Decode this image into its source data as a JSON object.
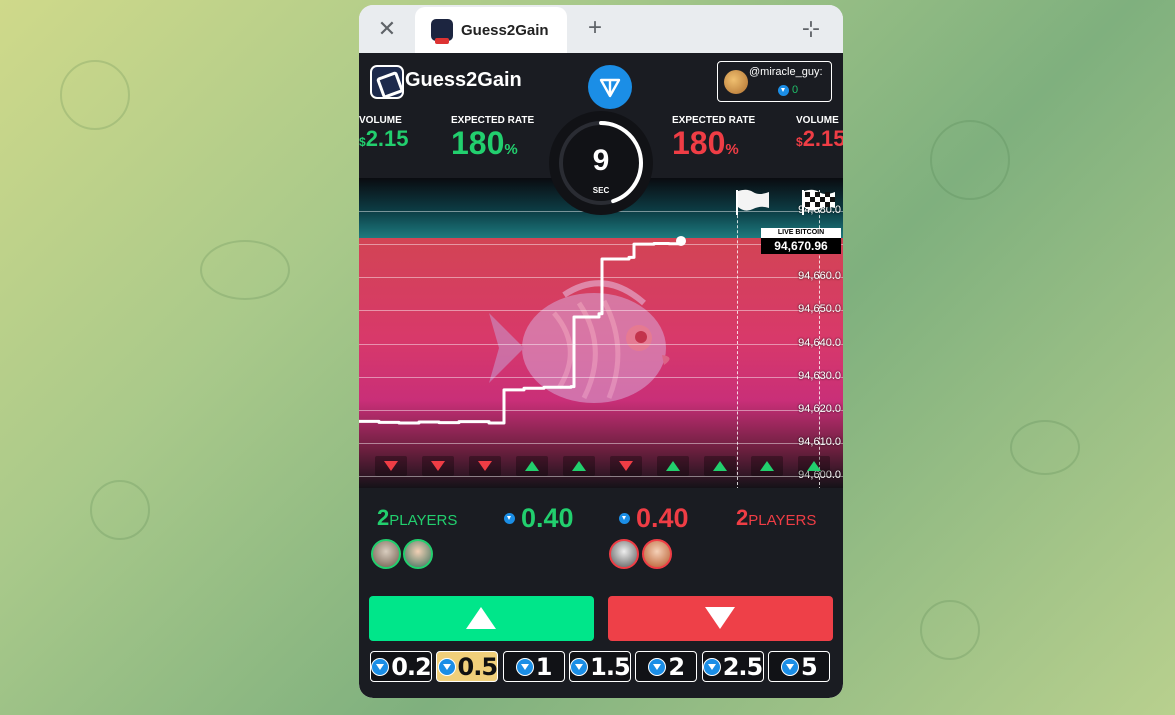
{
  "window": {
    "tab_title": "Guess2Gain"
  },
  "header": {
    "app_name": "Guess2Gain",
    "username": "@miracle_guy:",
    "balance": "0"
  },
  "stats": {
    "up": {
      "volume_label": "VOLUME",
      "volume_currency": "$",
      "volume_value": "2.15",
      "rate_label": "EXPECTED RATE",
      "rate_value": "180",
      "rate_unit": "%"
    },
    "down": {
      "volume_label": "VOLUME",
      "volume_currency": "$",
      "volume_value": "2.15",
      "rate_label": "EXPECTED RATE",
      "rate_value": "180",
      "rate_unit": "%"
    }
  },
  "timer": {
    "value": "9",
    "unit": "SEC",
    "progress_fraction": 0.45
  },
  "chart": {
    "live_label": "LIVE BITCOIN",
    "live_price": "94,670.96",
    "price_levels": [
      "94,680.0",
      "94,670.0",
      "94,660.0",
      "94,650.0",
      "94,640.0",
      "94,630.0",
      "94,620.0",
      "94,610.0",
      "94,600.0"
    ],
    "history": [
      "down",
      "down",
      "down",
      "up",
      "up",
      "down",
      "up",
      "up",
      "up",
      "up"
    ]
  },
  "chart_data": {
    "type": "line",
    "title": "",
    "ylabel": "",
    "ylim": [
      94600,
      94680
    ],
    "series": [
      {
        "values": [
          94616.5,
          94616.2,
          94616.0,
          94616.3,
          94616.1,
          94616.4,
          94616.0,
          94626.0,
          94626.5,
          94626.8,
          94627.0,
          94648.0,
          94649.0,
          94665.5,
          94666.0,
          94670.0,
          94670.2,
          94670.1,
          94670.96
        ]
      }
    ]
  },
  "players": {
    "up": {
      "count": "2",
      "label": "PLAYERS",
      "pool": "0.40"
    },
    "down": {
      "count": "2",
      "label": "PLAYERS",
      "pool": "0.40"
    }
  },
  "colors": {
    "up": "#22cf6e",
    "down": "#ef3d45",
    "up_button": "#00e68a",
    "down_button": "#ee4048",
    "selected_amount": "#f0cf7a"
  },
  "amounts": [
    "0.2",
    "0.5",
    "1",
    "1.5",
    "2",
    "2.5",
    "5"
  ],
  "selected_amount": "0.5"
}
